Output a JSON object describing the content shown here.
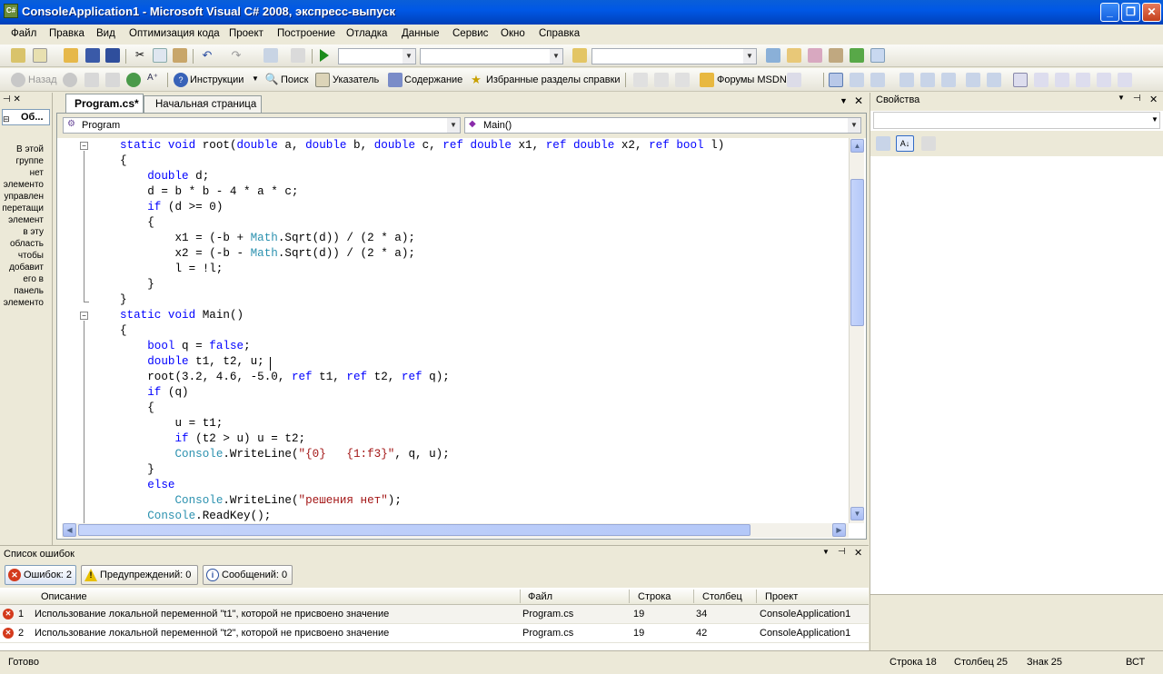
{
  "window": {
    "title": "ConsoleApplication1 - Microsoft Visual C# 2008, экспресс-выпуск",
    "app_icon": "C#"
  },
  "menu": [
    "Файл",
    "Правка",
    "Вид",
    "Оптимизация кода",
    "Проект",
    "Построение",
    "Отладка",
    "Данные",
    "Сервис",
    "Окно",
    "Справка"
  ],
  "toolbar2": {
    "back": "Назад",
    "instructions": "Инструкции",
    "search": "Поиск",
    "index": "Указатель",
    "contents": "Содержание",
    "favorites": "Избранные разделы справки",
    "forums": "Форумы MSDN"
  },
  "left_panel": {
    "title": "Об...",
    "text": [
      "В этой",
      "группе",
      "нет",
      "элементо",
      "управлен",
      "перетащи",
      "элемент",
      "в эту",
      "область",
      "чтобы",
      "добавит",
      "его в",
      "панель",
      "элементо"
    ]
  },
  "tabs": {
    "active": "Program.cs*",
    "other": "Начальная страница"
  },
  "editor": {
    "class_combo": "Program",
    "member_combo": "Main()"
  },
  "code": [
    [
      [
        "    static void root(",
        "kw:static void"
      ]
    ],
    "x"
  ],
  "code_lines": [
    [
      {
        "t": "static",
        "c": "kw"
      },
      {
        "t": " "
      },
      {
        "t": "void",
        "c": "kw"
      },
      {
        "t": " root("
      },
      {
        "t": "double",
        "c": "kw"
      },
      {
        "t": " a, "
      },
      {
        "t": "double",
        "c": "kw"
      },
      {
        "t": " b, "
      },
      {
        "t": "double",
        "c": "kw"
      },
      {
        "t": " c, "
      },
      {
        "t": "ref",
        "c": "kw"
      },
      {
        "t": " "
      },
      {
        "t": "double",
        "c": "kw"
      },
      {
        "t": " x1, "
      },
      {
        "t": "ref",
        "c": "kw"
      },
      {
        "t": " "
      },
      {
        "t": "double",
        "c": "kw"
      },
      {
        "t": " x2, "
      },
      {
        "t": "ref",
        "c": "kw"
      },
      {
        "t": " "
      },
      {
        "t": "bool",
        "c": "kw"
      },
      {
        "t": " l)"
      }
    ],
    [
      {
        "t": "{"
      }
    ],
    [
      {
        "t": "    "
      },
      {
        "t": "double",
        "c": "kw"
      },
      {
        "t": " d;"
      }
    ],
    [
      {
        "t": "    d = b * b - 4 * a * c;"
      }
    ],
    [
      {
        "t": "    "
      },
      {
        "t": "if",
        "c": "kw"
      },
      {
        "t": " (d >= 0)"
      }
    ],
    [
      {
        "t": "    {"
      }
    ],
    [
      {
        "t": "        x1 = (-b + "
      },
      {
        "t": "Math",
        "c": "ty"
      },
      {
        "t": ".Sqrt(d)) / (2 * a);"
      }
    ],
    [
      {
        "t": "        x2 = (-b - "
      },
      {
        "t": "Math",
        "c": "ty"
      },
      {
        "t": ".Sqrt(d)) / (2 * a);"
      }
    ],
    [
      {
        "t": "        l = !l;"
      }
    ],
    [
      {
        "t": "    }"
      }
    ],
    [
      {
        "t": "}"
      }
    ],
    [
      {
        "t": "static",
        "c": "kw"
      },
      {
        "t": " "
      },
      {
        "t": "void",
        "c": "kw"
      },
      {
        "t": " Main()"
      }
    ],
    [
      {
        "t": "{"
      }
    ],
    [
      {
        "t": "    "
      },
      {
        "t": "bool",
        "c": "kw"
      },
      {
        "t": " q = "
      },
      {
        "t": "false",
        "c": "kw"
      },
      {
        "t": ";"
      }
    ],
    [
      {
        "t": "    "
      },
      {
        "t": "double",
        "c": "kw"
      },
      {
        "t": " t1, t2, u;"
      }
    ],
    [
      {
        "t": "    root(3.2, 4.6, -5.0, "
      },
      {
        "t": "ref",
        "c": "kw"
      },
      {
        "t": " t1, "
      },
      {
        "t": "ref",
        "c": "kw"
      },
      {
        "t": " t2, "
      },
      {
        "t": "ref",
        "c": "kw"
      },
      {
        "t": " q);"
      }
    ],
    [
      {
        "t": "    "
      },
      {
        "t": "if",
        "c": "kw"
      },
      {
        "t": " (q)"
      }
    ],
    [
      {
        "t": "    {"
      }
    ],
    [
      {
        "t": "        u = t1;"
      }
    ],
    [
      {
        "t": "        "
      },
      {
        "t": "if",
        "c": "kw"
      },
      {
        "t": " (t2 > u) u = t2;"
      }
    ],
    [
      {
        "t": "        "
      },
      {
        "t": "Console",
        "c": "ty"
      },
      {
        "t": ".WriteLine("
      },
      {
        "t": "\"{0}   {1:f3}\"",
        "c": "st"
      },
      {
        "t": ", q, u);"
      }
    ],
    [
      {
        "t": "    }"
      }
    ],
    [
      {
        "t": "    "
      },
      {
        "t": "else",
        "c": "kw"
      }
    ],
    [
      {
        "t": "        "
      },
      {
        "t": "Console",
        "c": "ty"
      },
      {
        "t": ".WriteLine("
      },
      {
        "t": "\"решения нет\"",
        "c": "st"
      },
      {
        "t": ");"
      }
    ],
    [
      {
        "t": "    "
      },
      {
        "t": "Console",
        "c": "ty"
      },
      {
        "t": ".ReadKey();"
      }
    ]
  ],
  "properties": {
    "title": "Свойства"
  },
  "errors": {
    "title": "Список ошибок",
    "tab_errors": "Ошибок: 2",
    "tab_warnings": "Предупреждений: 0",
    "tab_messages": "Сообщений: 0",
    "columns": [
      "Описание",
      "Файл",
      "Строка",
      "Столбец",
      "Проект"
    ],
    "rows": [
      {
        "n": "1",
        "desc": "Использование локальной переменной \"t1\", которой не присвоено значение",
        "file": "Program.cs",
        "line": "19",
        "col": "34",
        "project": "ConsoleApplication1"
      },
      {
        "n": "2",
        "desc": "Использование локальной переменной \"t2\", которой не присвоено значение",
        "file": "Program.cs",
        "line": "19",
        "col": "42",
        "project": "ConsoleApplication1"
      }
    ]
  },
  "status": {
    "ready": "Готово",
    "line": "Строка 18",
    "col": "Столбец 25",
    "char": "Знак 25",
    "mode": "ВСТ"
  }
}
